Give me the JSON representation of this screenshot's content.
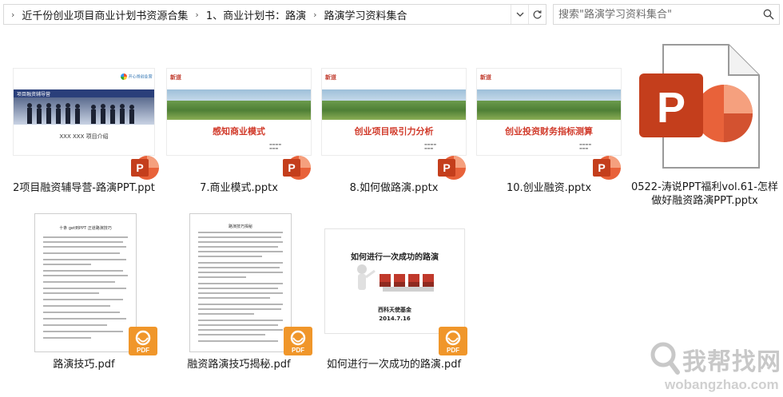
{
  "address_bar": {
    "crumbs": [
      "近千份创业项目商业计划书资源合集",
      "1、商业计划书：路演",
      "路演学习资料集合"
    ]
  },
  "search": {
    "placeholder": "搜索\"路演学习资料集合\""
  },
  "files": [
    {
      "name": "2项目融资辅导营-路演PPT.ppt",
      "type": "ppt",
      "thumb_text": {
        "header": "项目融资辅导营",
        "body": "XXX  XXX  项目介绍",
        "logo": "开心哥创业营"
      }
    },
    {
      "name": "7.商业模式.pptx",
      "type": "pptx",
      "thumb_text": {
        "brand": "新道",
        "title": "感知商业模式"
      }
    },
    {
      "name": "8.如何做路演.pptx",
      "type": "pptx",
      "thumb_text": {
        "brand": "新道",
        "title": "创业项目吸引力分析"
      }
    },
    {
      "name": "10.创业融资.pptx",
      "type": "pptx",
      "thumb_text": {
        "brand": "新道",
        "title": "创业投资财务指标测算"
      }
    },
    {
      "name": "0522-涛说PPT福利vol.61-怎样做好融资路演PPT.pptx",
      "type": "pptx-icon"
    },
    {
      "name": "路演技巧.pdf",
      "type": "pdf",
      "thumb_text": {
        "title": "十条 get到PPT 正道路演技巧"
      }
    },
    {
      "name": "融资路演技巧揭秘.pdf",
      "type": "pdf",
      "thumb_text": {
        "title": "路演技巧揭秘"
      }
    },
    {
      "name": "如何进行一次成功的路演.pdf",
      "type": "pdf",
      "thumb_text": {
        "title": "如何进行一次成功的路演",
        "org": "西科天使基金",
        "date": "2014.7.16"
      }
    }
  ],
  "badges": {
    "pdf_label": "PDF"
  },
  "colors": {
    "ppt_red": "#d35230",
    "ppt_orange": "#e8623a",
    "pdf_orange": "#f0962a",
    "title_red": "#d13b2b"
  },
  "watermark": {
    "logo_text": "我帮找网",
    "url": "wobangzhao.com"
  }
}
